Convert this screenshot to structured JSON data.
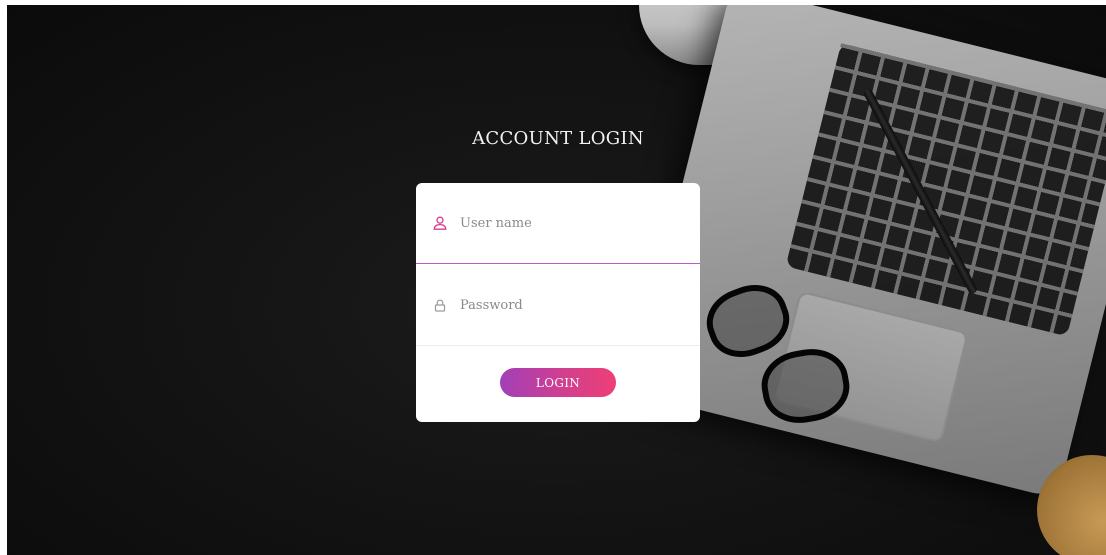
{
  "login": {
    "title": "ACCOUNT LOGIN",
    "username": {
      "placeholder": "User name",
      "value": "",
      "icon": "user-icon",
      "icon_color": "#d63a8f"
    },
    "password": {
      "placeholder": "Password",
      "value": "",
      "icon": "lock-icon",
      "icon_color": "#9a9a9a"
    },
    "button_label": "LOGIN",
    "button_gradient": [
      "#a23fb8",
      "#ee3f76"
    ]
  },
  "background": {
    "theme_color": "#141414",
    "objects": [
      "coffee-cup",
      "laptop",
      "pen",
      "glasses",
      "coaster"
    ]
  }
}
